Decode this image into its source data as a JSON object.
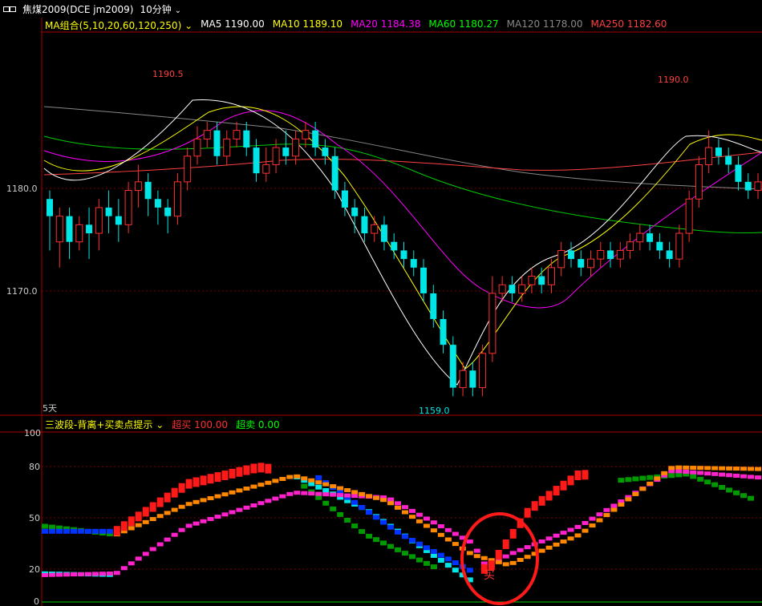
{
  "header": {
    "symbol": "焦煤2009(DCE jm2009)",
    "period": "10分钟"
  },
  "main_indicator": {
    "name": "MA组合(5,10,20,60,120,250)",
    "items": [
      {
        "label": "MA5 1190.00",
        "color": "#ffffff"
      },
      {
        "label": "MA10 1189.10",
        "color": "#ffff00"
      },
      {
        "label": "MA20 1184.38",
        "color": "#ff00ff"
      },
      {
        "label": "MA60 1180.27",
        "color": "#00ff00"
      },
      {
        "label": "MA120 1178.00",
        "color": "#888888"
      },
      {
        "label": "MA250 1182.60",
        "color": "#ff4040"
      }
    ]
  },
  "price_axis": {
    "ticks": [
      "1180.0",
      "1170.0"
    ]
  },
  "annotations": {
    "high_left": "1190.5",
    "high_right": "1190.0",
    "low": "1159.0",
    "days": "5天"
  },
  "sub_indicator": {
    "name": "三波段-背离+买卖点提示",
    "overbought": "超买 100.00",
    "oversold": "超卖 0.00",
    "ticks": [
      "100",
      "80",
      "50",
      "20",
      "0"
    ]
  },
  "colors": {
    "up": "#ff3030",
    "down": "#00e5e5",
    "grid": "#8b0000",
    "axis": "#aa0000"
  },
  "chart_data": {
    "type": "candlestick",
    "ylim": [
      1158,
      1201
    ],
    "candles": [
      [
        1182,
        1180,
        1183,
        1176
      ],
      [
        1177,
        1180,
        1181,
        1174
      ],
      [
        1180,
        1177,
        1181,
        1175
      ],
      [
        1177,
        1179,
        1180,
        1176
      ],
      [
        1179,
        1178,
        1181,
        1175
      ],
      [
        1178,
        1181,
        1182,
        1176
      ],
      [
        1181,
        1180,
        1183,
        1178
      ],
      [
        1180,
        1179,
        1182,
        1177
      ],
      [
        1179,
        1183,
        1184,
        1178
      ],
      [
        1183,
        1184,
        1186,
        1181
      ],
      [
        1184,
        1182,
        1185,
        1180
      ],
      [
        1182,
        1181,
        1183,
        1179
      ],
      [
        1181,
        1180,
        1182,
        1178
      ],
      [
        1180,
        1184,
        1185,
        1179
      ],
      [
        1184,
        1187,
        1188,
        1183
      ],
      [
        1187,
        1189,
        1190.5,
        1186
      ],
      [
        1189,
        1190,
        1191,
        1188
      ],
      [
        1190,
        1187,
        1191,
        1186
      ],
      [
        1187,
        1189,
        1190,
        1186
      ],
      [
        1189,
        1190,
        1191,
        1188
      ],
      [
        1190,
        1188,
        1191,
        1187
      ],
      [
        1188,
        1185,
        1189,
        1184
      ],
      [
        1185,
        1186,
        1188,
        1184
      ],
      [
        1186,
        1188,
        1189,
        1185
      ],
      [
        1188,
        1187,
        1190,
        1186
      ],
      [
        1187,
        1189,
        1190,
        1186
      ],
      [
        1189,
        1190,
        1191,
        1188
      ],
      [
        1190,
        1188,
        1191,
        1187
      ],
      [
        1188,
        1187,
        1189,
        1186
      ],
      [
        1187,
        1183,
        1188,
        1182
      ],
      [
        1183,
        1181,
        1184,
        1180
      ],
      [
        1181,
        1180,
        1182,
        1178
      ],
      [
        1180,
        1178,
        1181,
        1177
      ],
      [
        1178,
        1179,
        1180,
        1177
      ],
      [
        1179,
        1177,
        1180,
        1176
      ],
      [
        1177,
        1176,
        1178,
        1175
      ],
      [
        1176,
        1175,
        1177,
        1174
      ],
      [
        1175,
        1174,
        1176,
        1173
      ],
      [
        1174,
        1171,
        1175,
        1170
      ],
      [
        1171,
        1168,
        1172,
        1167
      ],
      [
        1168,
        1165,
        1169,
        1164
      ],
      [
        1165,
        1160,
        1166,
        1159
      ],
      [
        1160,
        1162,
        1163,
        1159
      ],
      [
        1162,
        1160,
        1163,
        1159
      ],
      [
        1160,
        1164,
        1165,
        1159
      ],
      [
        1164,
        1171,
        1173,
        1163
      ],
      [
        1171,
        1172,
        1173,
        1170
      ],
      [
        1172,
        1171,
        1173,
        1170
      ],
      [
        1171,
        1172,
        1173,
        1170
      ],
      [
        1172,
        1173,
        1174,
        1171
      ],
      [
        1173,
        1172,
        1174,
        1171
      ],
      [
        1172,
        1174,
        1175,
        1171
      ],
      [
        1174,
        1176,
        1177,
        1173
      ],
      [
        1176,
        1175,
        1177,
        1174
      ],
      [
        1175,
        1174,
        1176,
        1173
      ],
      [
        1174,
        1175,
        1176,
        1173
      ],
      [
        1175,
        1176,
        1177,
        1174
      ],
      [
        1176,
        1175,
        1177,
        1174
      ],
      [
        1175,
        1176,
        1177,
        1174
      ],
      [
        1176,
        1177,
        1178,
        1175
      ],
      [
        1177,
        1178,
        1179,
        1176
      ],
      [
        1178,
        1177,
        1179,
        1176
      ],
      [
        1177,
        1176,
        1178,
        1175
      ],
      [
        1176,
        1175,
        1177,
        1174
      ],
      [
        1175,
        1178,
        1179,
        1174
      ],
      [
        1178,
        1182,
        1183,
        1177
      ],
      [
        1182,
        1186,
        1187,
        1181
      ],
      [
        1186,
        1188,
        1190,
        1185
      ],
      [
        1188,
        1187,
        1189,
        1186
      ],
      [
        1187,
        1186,
        1188,
        1185
      ],
      [
        1186,
        1184,
        1187,
        1183
      ],
      [
        1184,
        1183,
        1185,
        1182
      ],
      [
        1183,
        1184,
        1185,
        1182
      ]
    ]
  }
}
